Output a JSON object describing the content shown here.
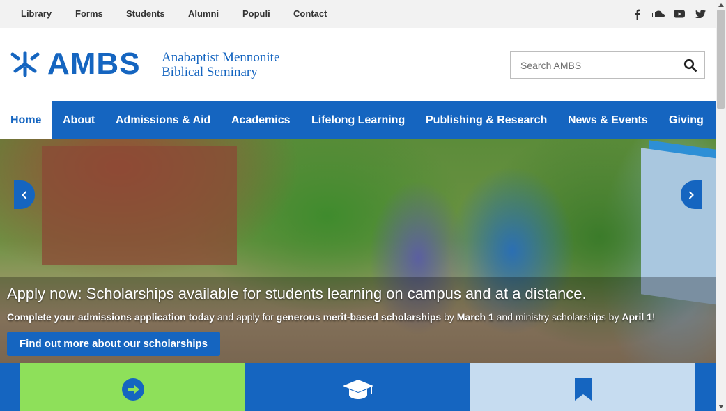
{
  "utility_nav": [
    "Library",
    "Forms",
    "Students",
    "Alumni",
    "Populi",
    "Contact"
  ],
  "social_icons": [
    "facebook-icon",
    "soundcloud-icon",
    "youtube-icon",
    "twitter-icon"
  ],
  "logo": {
    "wordmark": "AMBS",
    "line1": "Anabaptist Mennonite",
    "line2": "Biblical Seminary"
  },
  "search": {
    "placeholder": "Search AMBS"
  },
  "main_nav": {
    "active": "Home",
    "items": [
      "Home",
      "About",
      "Admissions & Aid",
      "Academics",
      "Lifelong Learning",
      "Publishing & Research",
      "News & Events",
      "Giving"
    ]
  },
  "hero": {
    "title": "Apply now: Scholarships available for students learning on campus and at a distance.",
    "sub": {
      "p1": "Complete your admissions application today",
      "p2": " and apply for ",
      "p3": "generous merit-based scholarships",
      "p4": " by ",
      "p5": "March 1",
      "p6": " and ministry scholarships by ",
      "p7": "April 1",
      "p8": "!"
    },
    "button": "Find out more about our scholarships"
  },
  "tiles": [
    {
      "icon": "arrow-circle-right-icon",
      "bg": "#8ee05a",
      "icon_color": "#1565c0"
    },
    {
      "icon": "graduation-cap-icon",
      "bg": "#1565c0",
      "icon_color": "#ffffff"
    },
    {
      "icon": "bookmark-icon",
      "bg": "#c6dcf0",
      "icon_color": "#1565c0"
    }
  ],
  "colors": {
    "brand_blue": "#1565c0",
    "topbar": "#f2f2f2"
  }
}
